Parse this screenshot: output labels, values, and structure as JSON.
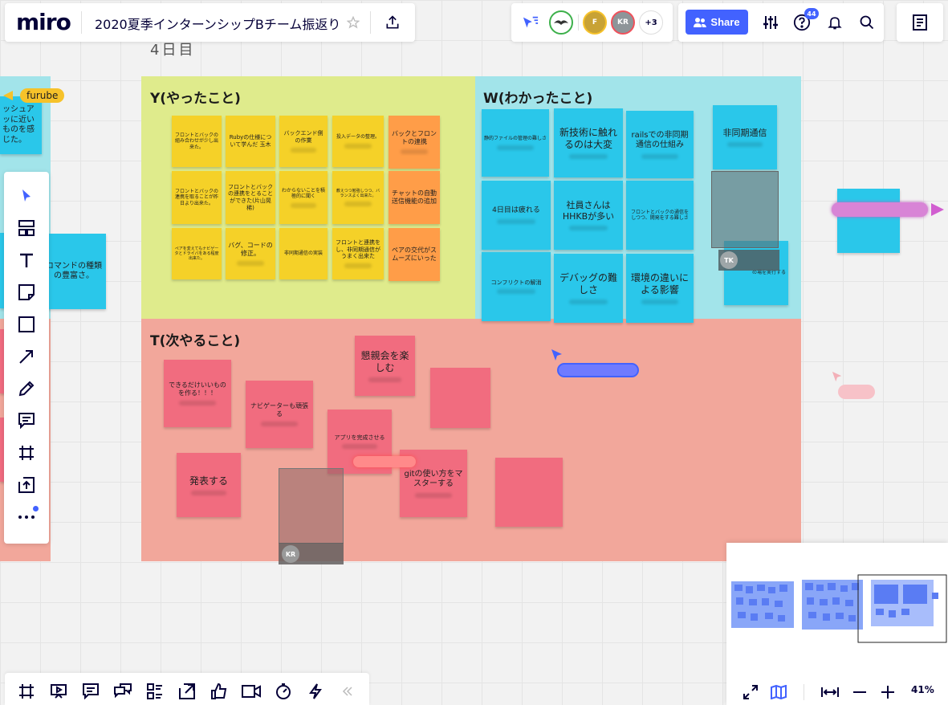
{
  "app": {
    "logo": "miro",
    "board_title": "2020夏季インターンシップBチーム振返り",
    "share_label": "Share",
    "notification_count": "44",
    "extra_collaborators": "+3",
    "avatar_f": "F",
    "avatar_kr": "KR",
    "zoom_level": "41%"
  },
  "canvas": {
    "day_label": "4日目",
    "frames": {
      "y_title": "Y(やったこと)",
      "w_title": "W(わかったこと)",
      "t_title": "T(次やること)"
    },
    "y_stickies": [
      "フロントとバックの組み合わせが少し出来た。",
      "Rubyの仕様について学んだ 玉木",
      "バックエンド側の作業",
      "投入データの整理。",
      "バックとフロントの連携",
      "フロントとバックの連携を取ることが昨日より出来た。",
      "フロントとバックの連携をとることができた(片山晃稀)",
      "わからないことを積極的に聞く",
      "教えつつ勉強しつつ、バランスよく出来た。",
      "チャットの自動送信機能の追加",
      "ペアを変えてもナビゲータとドライバをある程度出来た。",
      "バグ、コードの修正。",
      "非同期通信の実装",
      "フロントと連携をし、非同期通信がうまく出来た",
      "ペアの交代がスムーズにいった"
    ],
    "w_stickies": [
      "静的ファイルの管理の難しさ",
      "新技術に触れるのは大変",
      "railsでの非同期通信の仕組み",
      "非同期通信",
      "4日目は疲れる",
      "社員さんはHHKBが多い",
      "フロントとバックの通信をしつつ、開発をする難しさ",
      "コンフリクトの解消",
      "デバッグの難しさ",
      "環境の違いによる影響",
      "の場を実行する"
    ],
    "t_stickies": [
      "懇親会を楽しむ",
      "できるだけいいものを作る！！！",
      "ナビゲーターも頑張る",
      "アプリを完成させる",
      "発表する",
      "gitの使い方をマスターする"
    ],
    "left_stickies": [
      "ッシュアッに近いものを感じた。",
      "コマンドの種類の豊富さ。"
    ],
    "cursor_labels": {
      "furube": "furube"
    },
    "initials": {
      "tk": "TK",
      "kr": "KR"
    }
  },
  "colors": {
    "yellow_frame": "#dfeb8c",
    "cyan_frame": "#a2e4ea",
    "red_frame": "#f2a79b",
    "accent": "#4262ff",
    "sticky_yellow": "#f5d128",
    "sticky_orange": "#ff9d48",
    "sticky_cyan": "#2ac7ea",
    "sticky_pink": "#f16c7f"
  }
}
